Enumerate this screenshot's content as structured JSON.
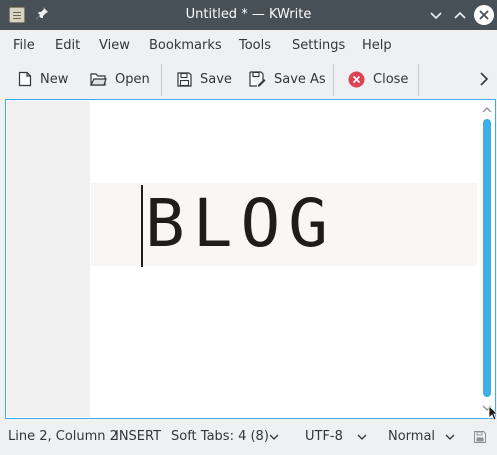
{
  "window": {
    "title": "Untitled * — KWrite",
    "icons": [
      "kwrite-app-icon",
      "pin-icon",
      "minimize-icon",
      "maximize-icon",
      "close-window-icon"
    ]
  },
  "menubar": {
    "items": [
      "File",
      "Edit",
      "View",
      "Bookmarks",
      "Tools",
      "Settings",
      "Help"
    ]
  },
  "toolbar": {
    "new_label": "New",
    "open_label": "Open",
    "save_label": "Save",
    "save_as_label": "Save As",
    "close_label": "Close"
  },
  "editor": {
    "content": "BLOG"
  },
  "statusbar": {
    "cursor_position": "Line 2, Column 2",
    "mode": "INSERT",
    "indentation": "Soft Tabs: 4 (8)",
    "encoding": "UTF-8",
    "highlighting": "Normal"
  },
  "colors": {
    "accent": "#3daee9",
    "titlebar": "#475057",
    "close_icon": "#da4453"
  }
}
